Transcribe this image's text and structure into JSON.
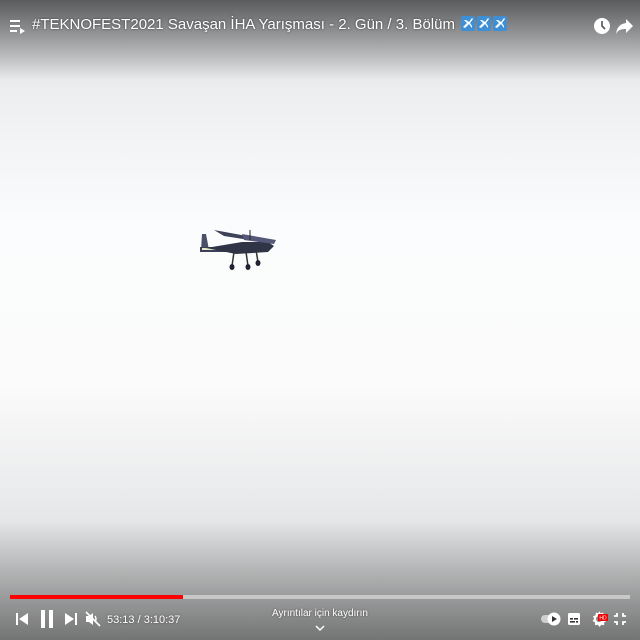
{
  "video": {
    "title": "#TEKNOFEST2021 Savaşan İHA Yarışması - 2. Gün / 3. Bölüm",
    "title_emojis": [
      "airplane-emoji",
      "airplane-emoji",
      "airplane-emoji"
    ]
  },
  "topbar": {
    "left_icon": "playlist-queue-icon",
    "right_icons": [
      "watch-later-clock-icon",
      "share-arrow-icon"
    ]
  },
  "player": {
    "current_time": "53:13",
    "separator": " / ",
    "duration": "3:10:37",
    "progress_fraction": 0.279,
    "scroll_hint": "Ayrıntılar için kaydırın",
    "accent_color": "#ff0000",
    "controls_left": [
      "previous-icon",
      "pause-icon",
      "next-icon",
      "mute-icon"
    ],
    "controls_right": [
      "autoplay-toggle-icon",
      "subtitles-icon",
      "quality-hd-icon",
      "exit-fullscreen-icon"
    ]
  }
}
